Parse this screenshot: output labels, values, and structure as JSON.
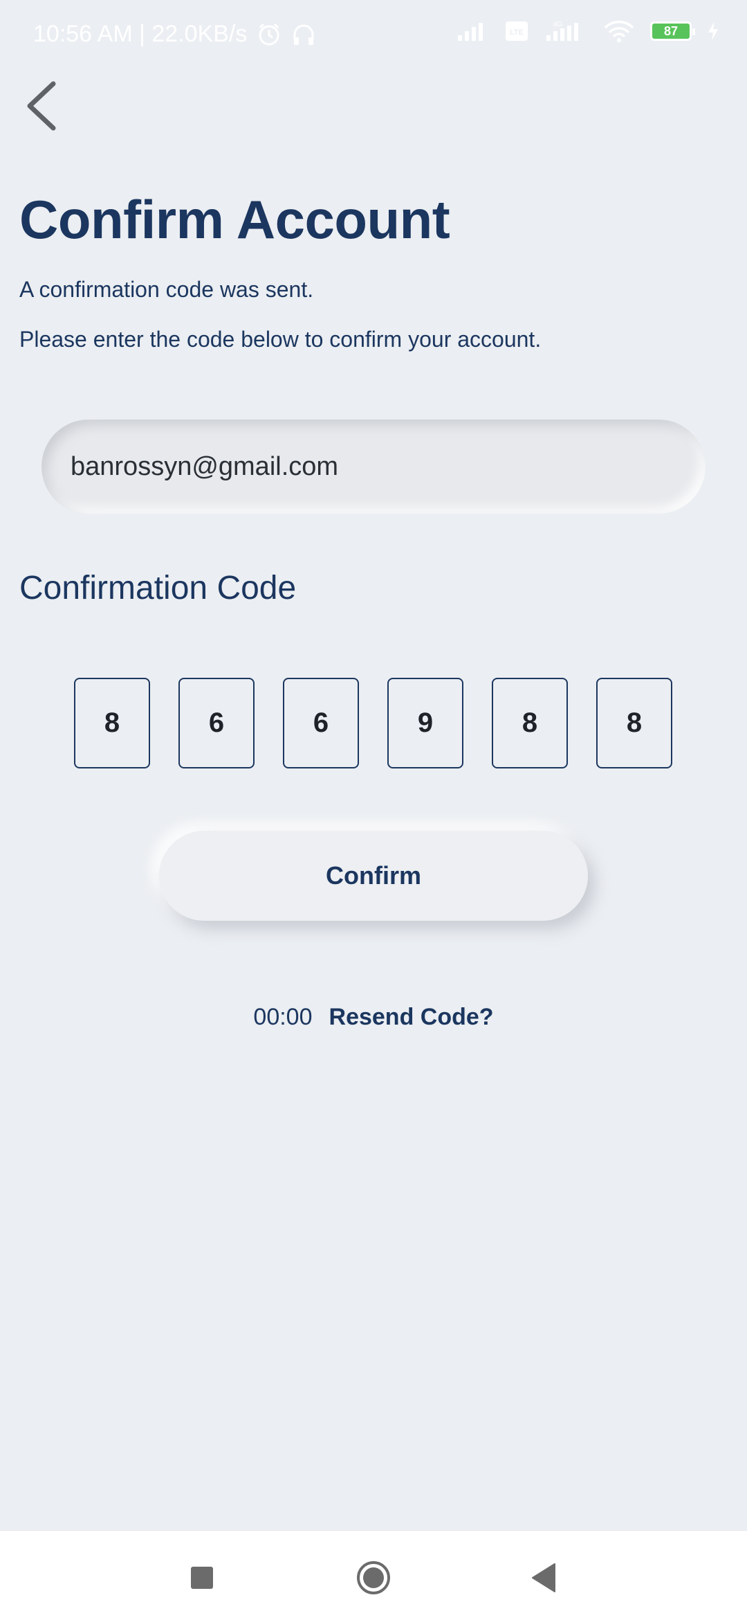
{
  "status_bar": {
    "time_speed": "10:56 AM | 22.0KB/s",
    "battery": "87",
    "icons": [
      "alarm-icon",
      "headphones-icon",
      "signal-icon",
      "volte-icon",
      "signal-4g-icon",
      "wifi-icon",
      "battery-icon",
      "charging-icon"
    ]
  },
  "header": {
    "back_icon": "chevron-left-icon"
  },
  "main": {
    "title": "Confirm Account",
    "subtitle_1": "A confirmation code was sent.",
    "subtitle_2": "Please enter the code below to confirm your account.",
    "email_value": "banrossyn@gmail.com",
    "code_label": "Confirmation Code",
    "code_digits": [
      "8",
      "6",
      "6",
      "9",
      "8",
      "8"
    ],
    "confirm_label": "Confirm",
    "timer": "00:00",
    "resend_label": "Resend Code?"
  },
  "nav": {
    "icons": [
      "recents-icon",
      "home-icon",
      "back-icon"
    ]
  },
  "colors": {
    "background": "#ebeef2",
    "primary_text": "#1b365f",
    "nav_background": "#ffffff"
  }
}
